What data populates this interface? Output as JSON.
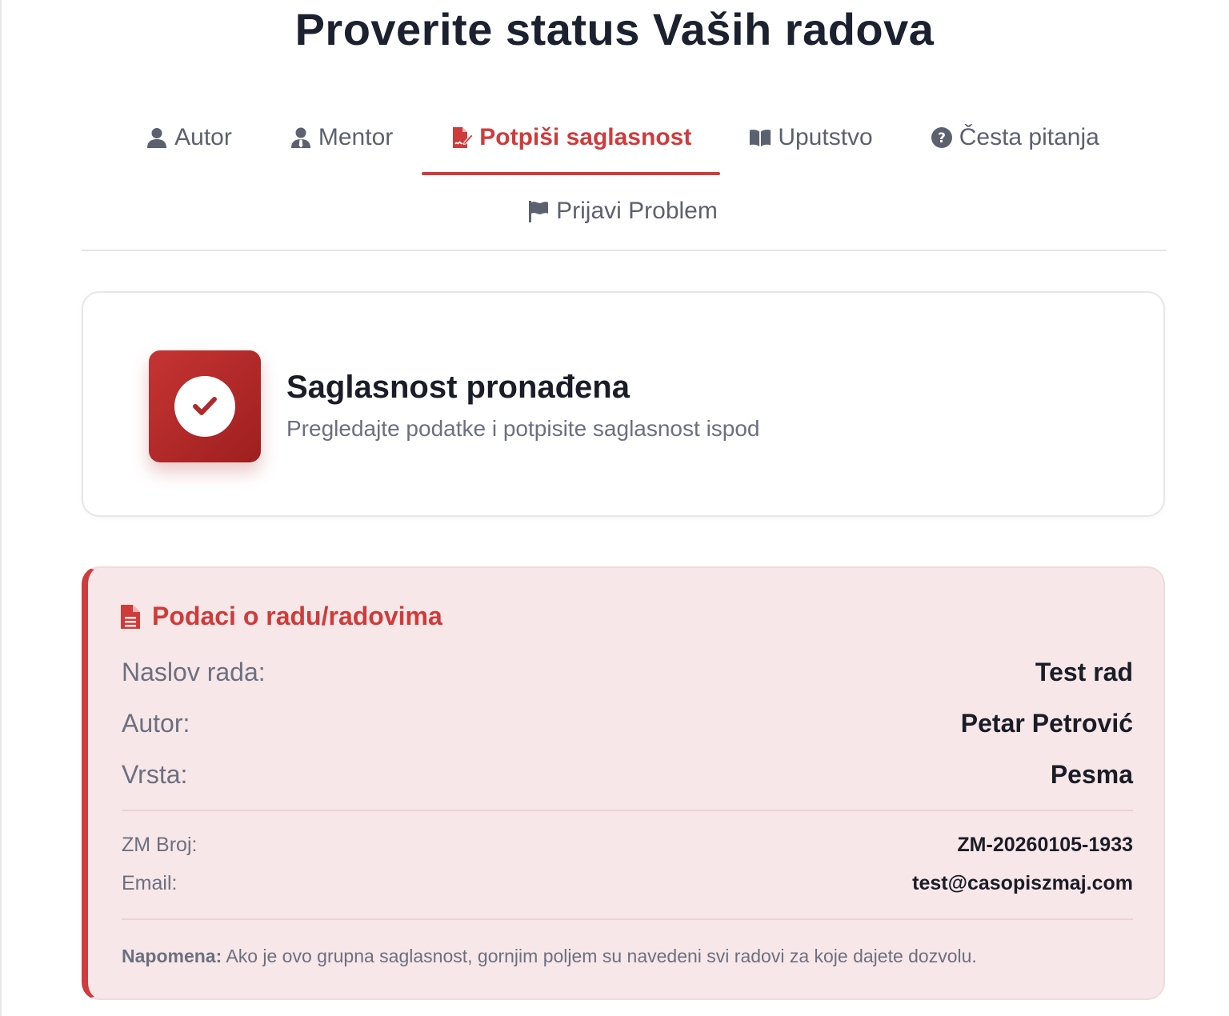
{
  "page_title": "Proverite status Vaših radova",
  "tabs": [
    {
      "label": "Autor",
      "icon": "user-icon",
      "active": false
    },
    {
      "label": "Mentor",
      "icon": "user-tie-icon",
      "active": false
    },
    {
      "label": "Potpiši saglasnost",
      "icon": "file-signature-icon",
      "active": true
    },
    {
      "label": "Uputstvo",
      "icon": "book-open-icon",
      "active": false
    },
    {
      "label": "Česta pitanja",
      "icon": "question-circle-icon",
      "active": false
    },
    {
      "label": "Prijavi Problem",
      "icon": "flag-icon",
      "active": false
    }
  ],
  "status": {
    "title": "Saglasnost pronađena",
    "subtitle": "Pregledajte podatke i potpisite saglasnost ispod",
    "icon": "check-circle-icon"
  },
  "work_info": {
    "heading": "Podaci o radu/radovima",
    "icon": "file-text-icon",
    "naslov_label": "Naslov rada:",
    "naslov_value": "Test rad",
    "autor_label": "Autor:",
    "autor_value": "Petar Petrović",
    "vrsta_label": "Vrsta:",
    "vrsta_value": "Pesma",
    "zm_label": "ZM Broj:",
    "zm_value": "ZM-20260105-1933",
    "email_label": "Email:",
    "email_value": "test@casopiszmaj.com",
    "note_label": "Napomena:",
    "note_text": " Ako je ovo grupna saglasnost, gornjim poljem su navedeni svi radovi za koje dajete dozvolu."
  },
  "colors": {
    "accent": "#cf3b3b",
    "info_bg": "#f8e7e8",
    "muted": "#6b7080",
    "heading": "#1c2130"
  }
}
